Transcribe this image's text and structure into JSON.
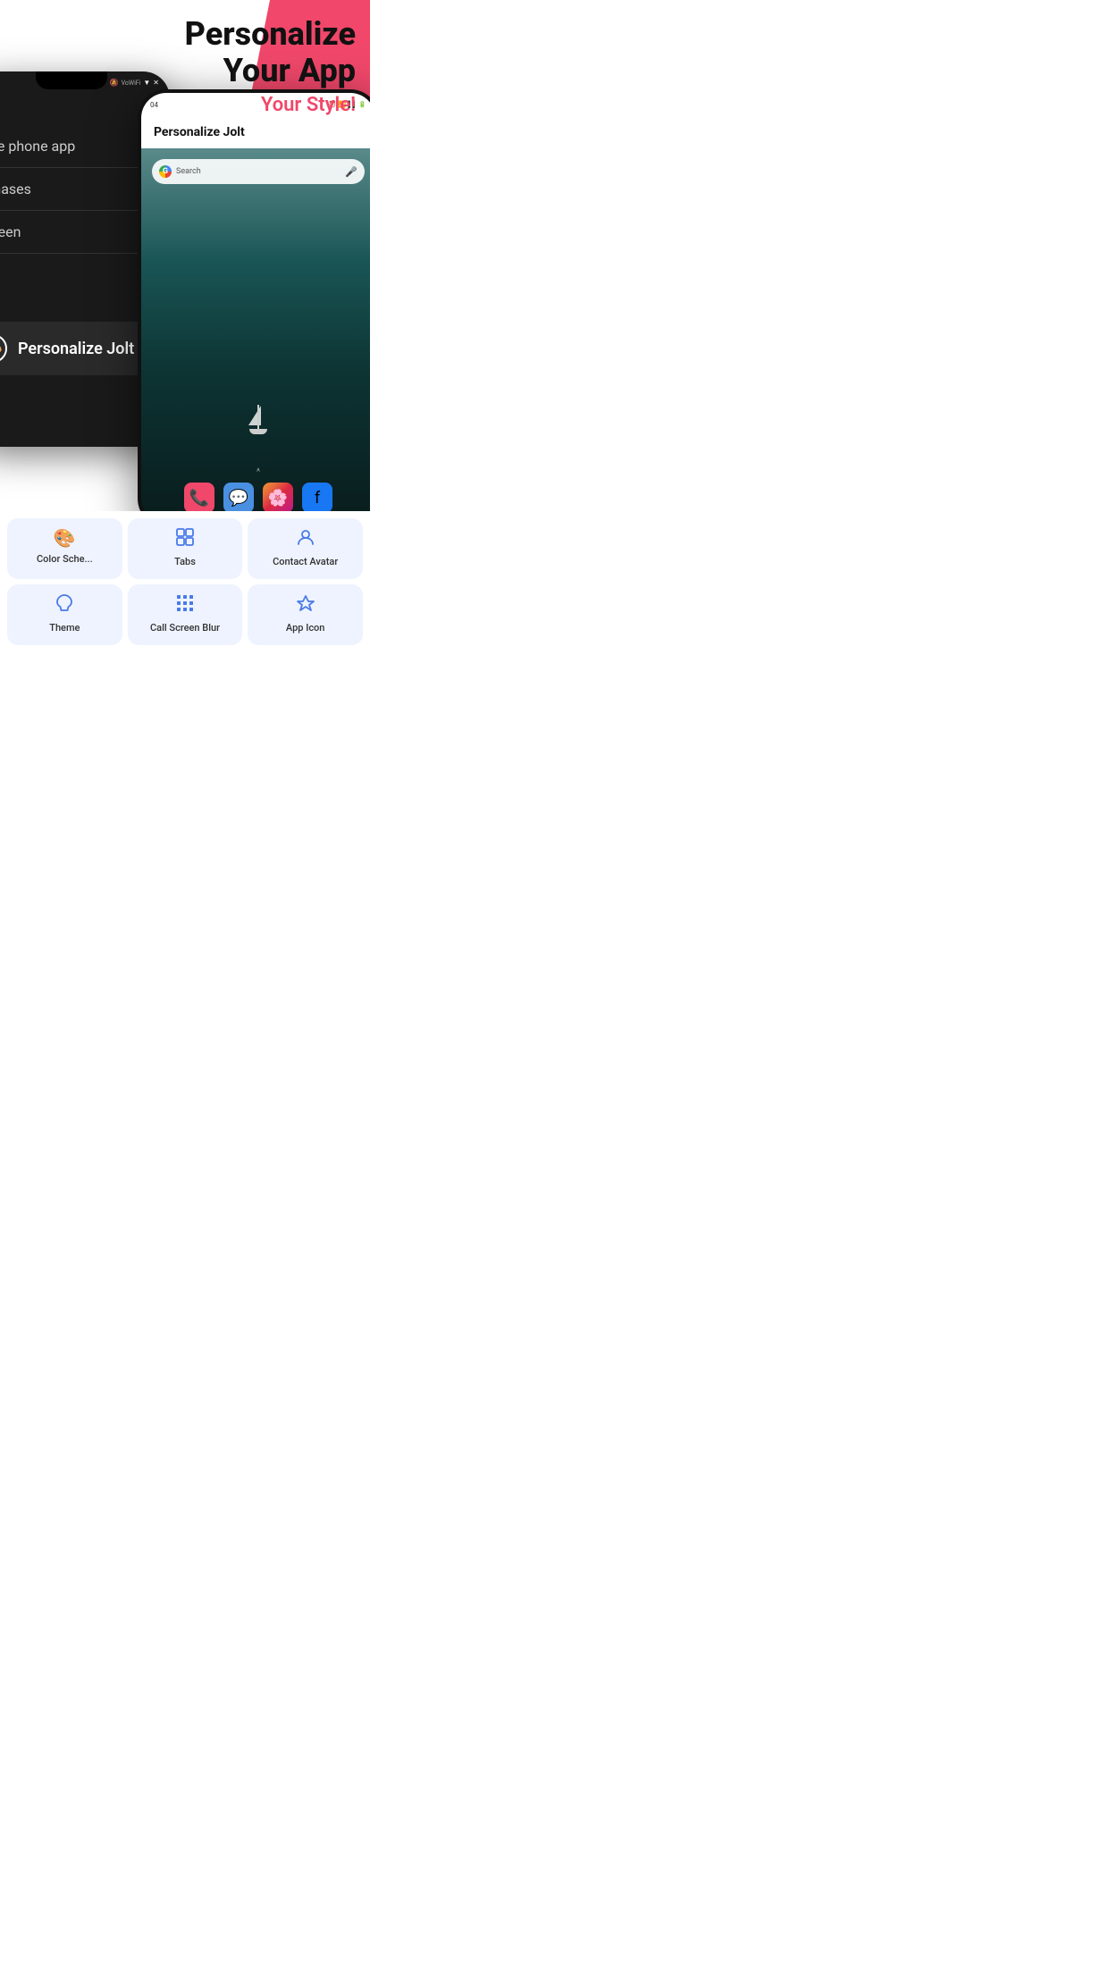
{
  "header": {
    "title_line1": "Personalize",
    "title_line2": "Your App",
    "subtitle": "Your Style!"
  },
  "left_phone": {
    "menu_items": [
      "ble phone app",
      "chases",
      "creen"
    ],
    "highlight_label": "Personalize Jolt"
  },
  "right_phone": {
    "status_left": "04",
    "title": "Personalize Jolt",
    "search_placeholder": "Search"
  },
  "features": {
    "row1": [
      {
        "icon": "🎨",
        "label": "Color Sche..."
      },
      {
        "icon": "⊞",
        "label": "Tabs"
      },
      {
        "icon": "👤",
        "label": "Contact Avatar"
      }
    ],
    "row2": [
      {
        "icon": "🌙",
        "label": "Theme"
      },
      {
        "icon": "⣿",
        "label": "Call Screen Blur"
      },
      {
        "icon": "△",
        "label": "App Icon"
      }
    ]
  },
  "colors": {
    "accent_pink": "#F0476A",
    "feature_bg": "#EEF3FF",
    "feature_icon": "#4A7AE8",
    "dark_phone_bg": "#1a1a1a"
  }
}
